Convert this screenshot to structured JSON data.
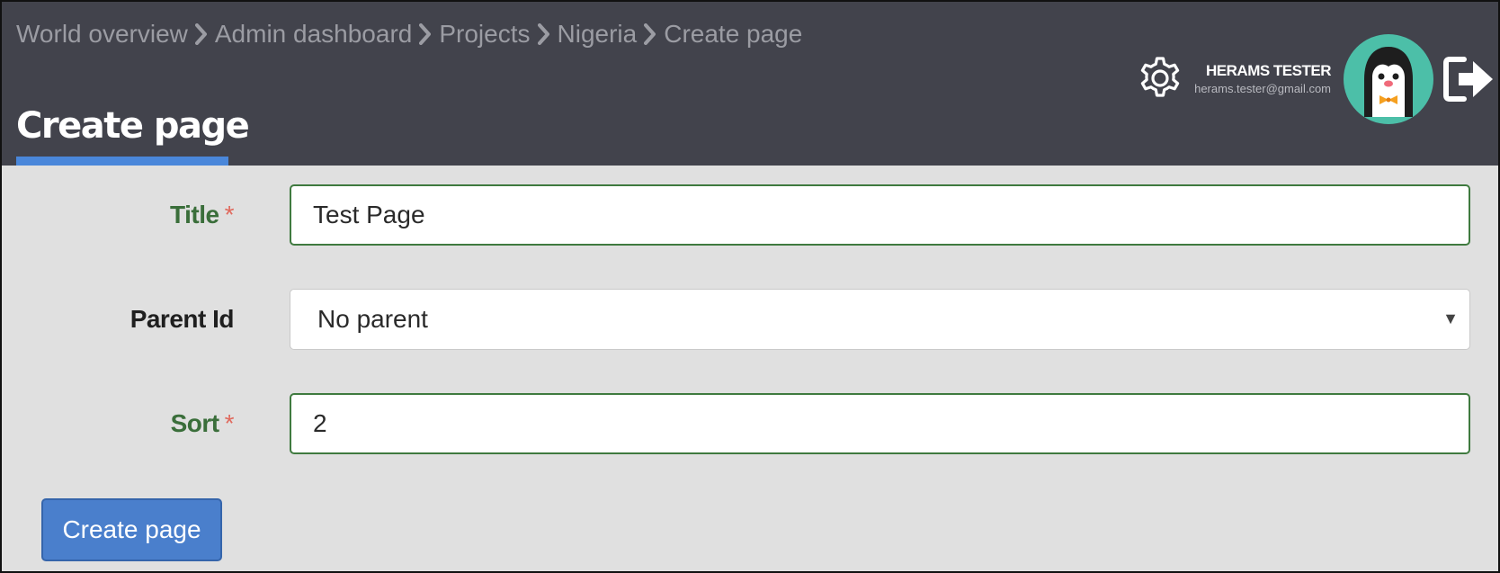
{
  "breadcrumb": [
    {
      "label": "World overview"
    },
    {
      "label": "Admin dashboard"
    },
    {
      "label": "Projects"
    },
    {
      "label": "Nigeria"
    },
    {
      "label": "Create page"
    }
  ],
  "header": {
    "page_title": "Create page",
    "accent_color": "#4a87da",
    "icons": {
      "settings": "gear-icon",
      "logout": "logout-icon",
      "avatar": "penguin-avatar"
    }
  },
  "user": {
    "name": "HERAMS TESTER",
    "email": "herams.tester@gmail.com"
  },
  "form": {
    "title": {
      "label": "Title",
      "required_mark": "*",
      "value": "Test Page"
    },
    "parent_id": {
      "label": "Parent Id",
      "selected": "No parent",
      "arrow": "▼"
    },
    "sort": {
      "label": "Sort",
      "required_mark": "*",
      "value": "2"
    },
    "submit_label": "Create page"
  }
}
